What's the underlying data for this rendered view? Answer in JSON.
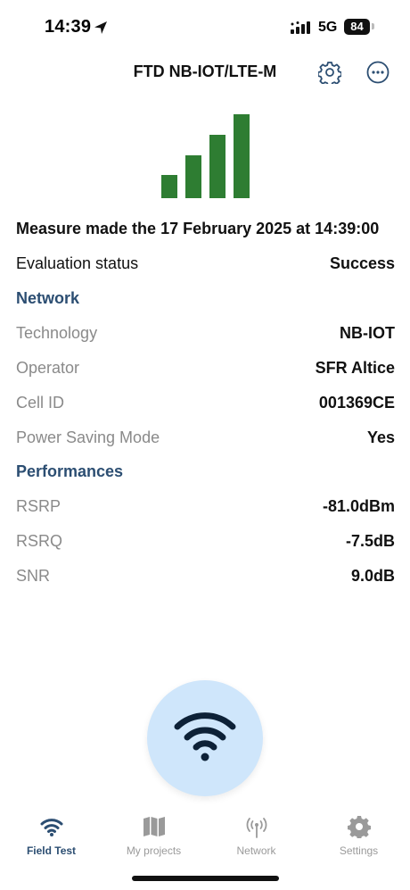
{
  "status_bar": {
    "time": "14:39",
    "network": "5G",
    "battery": "84"
  },
  "header": {
    "title": "FTD NB-IOT/LTE-M"
  },
  "signal": {
    "level": 4,
    "max_level": 4,
    "color": "#2e7d32"
  },
  "measure": {
    "prefix": "Measure made the ",
    "date": "17 February 2025",
    "at": " at ",
    "time": "14:39:00"
  },
  "evaluation": {
    "label": "Evaluation status",
    "value": "Success"
  },
  "network_section": {
    "title": "Network",
    "rows": [
      {
        "label": "Technology",
        "value": "NB-IOT"
      },
      {
        "label": "Operator",
        "value": "SFR Altice"
      },
      {
        "label": "Cell ID",
        "value": "001369CE"
      },
      {
        "label": "Power Saving Mode",
        "value": "Yes"
      }
    ]
  },
  "performances_section": {
    "title": "Performances",
    "rows": [
      {
        "label": "RSRP",
        "value": "-81.0dBm"
      },
      {
        "label": "RSRQ",
        "value": "-7.5dB"
      },
      {
        "label": "SNR",
        "value": "9.0dB"
      }
    ]
  },
  "tabs": [
    {
      "label": "Field Test",
      "icon": "wifi-icon",
      "active": true
    },
    {
      "label": "My projects",
      "icon": "map-icon",
      "active": false
    },
    {
      "label": "Network",
      "icon": "antenna-icon",
      "active": false
    },
    {
      "label": "Settings",
      "icon": "gear-icon",
      "active": false
    }
  ],
  "colors": {
    "accent": "#2c4e72",
    "fab_bg": "#cfe6fb",
    "signal_green": "#2e7d32",
    "muted": "#8a8a8a"
  }
}
